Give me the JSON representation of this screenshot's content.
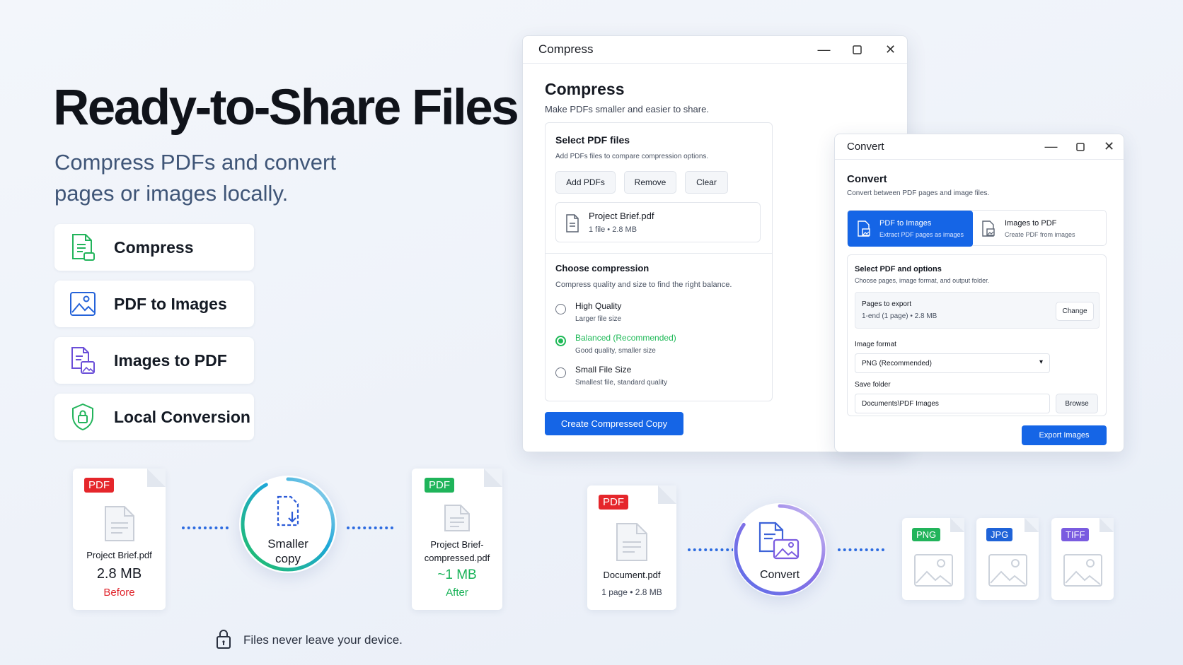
{
  "hero": {
    "title": "Ready-to-Share Files",
    "subtitle": "Compress PDFs and convert pages or images locally."
  },
  "features": [
    {
      "label": "Compress",
      "icon": "compress-doc-icon"
    },
    {
      "label": "PDF to Images",
      "icon": "image-icon"
    },
    {
      "label": "Images to PDF",
      "icon": "images-to-pdf-icon"
    },
    {
      "label": "Local Conversion",
      "icon": "shield-lock-icon"
    }
  ],
  "compress_window": {
    "window_title": "Compress",
    "heading": "Compress",
    "description": "Make PDFs smaller and easier to share.",
    "select": {
      "title": "Select PDF files",
      "hint": "Add PDFs files to compare compression options.",
      "buttons": [
        "Add PDFs",
        "Remove",
        "Clear"
      ],
      "file_name": "Project Brief.pdf",
      "file_meta": "1 file  •  2.8 MB"
    },
    "compression": {
      "title": "Choose compression",
      "hint": "Compress quality and size to find the right balance.",
      "options": [
        {
          "label": "High Quality",
          "sub": "Larger file size",
          "selected": false
        },
        {
          "label": "Balanced (Recommended)",
          "sub": "Good quality, smaller size",
          "selected": true
        },
        {
          "label": "Small File Size",
          "sub": "Smallest file, standard quality",
          "selected": false
        }
      ]
    },
    "primary_button": "Create Compressed Copy"
  },
  "convert_window": {
    "window_title": "Convert",
    "heading": "Convert",
    "description": "Convert between PDF pages and image files.",
    "tabs": [
      {
        "label": "PDF to Images",
        "sub": "Extract PDF pages as images",
        "active": true
      },
      {
        "label": "Images to PDF",
        "sub": "Create PDF from images",
        "active": false
      }
    ],
    "options": {
      "title": "Select PDF and options",
      "hint": "Choose pages, image format, and output folder.",
      "pages_label": "Pages to export",
      "pages_value": "1-end (1 page)  •  2.8 MB",
      "change_button": "Change",
      "format_label": "Image format",
      "format_value": "PNG (Recommended)",
      "folder_label": "Save folder",
      "folder_value": "Documents\\PDF Images",
      "browse_button": "Browse"
    },
    "primary_button": "Export Images"
  },
  "flow_compress": {
    "before": {
      "badge": "PDF",
      "name": "Project Brief.pdf",
      "size": "2.8 MB",
      "tag": "Before"
    },
    "step_label_1": "Smaller",
    "step_label_2": "copy",
    "after": {
      "badge": "PDF",
      "name_1": "Project Brief-",
      "name_2": "compressed.pdf",
      "size": "~1 MB",
      "tag": "After"
    }
  },
  "flow_convert": {
    "source": {
      "badge": "PDF",
      "name": "Document.pdf",
      "meta": "1 page  •  2.8 MB"
    },
    "step_label": "Convert",
    "outputs": [
      "PNG",
      "JPG",
      "TIFF"
    ]
  },
  "footer_note": "Files never leave your device.",
  "colors": {
    "accent": "#1565e6",
    "pdf_red": "#e5262b",
    "pdf_green": "#1fb45a",
    "before_red": "#e0242b",
    "after_green": "#17b257",
    "png_green": "#22b45b",
    "jpg_blue": "#1f63d8",
    "tiff_purple": "#7a5ce0"
  }
}
